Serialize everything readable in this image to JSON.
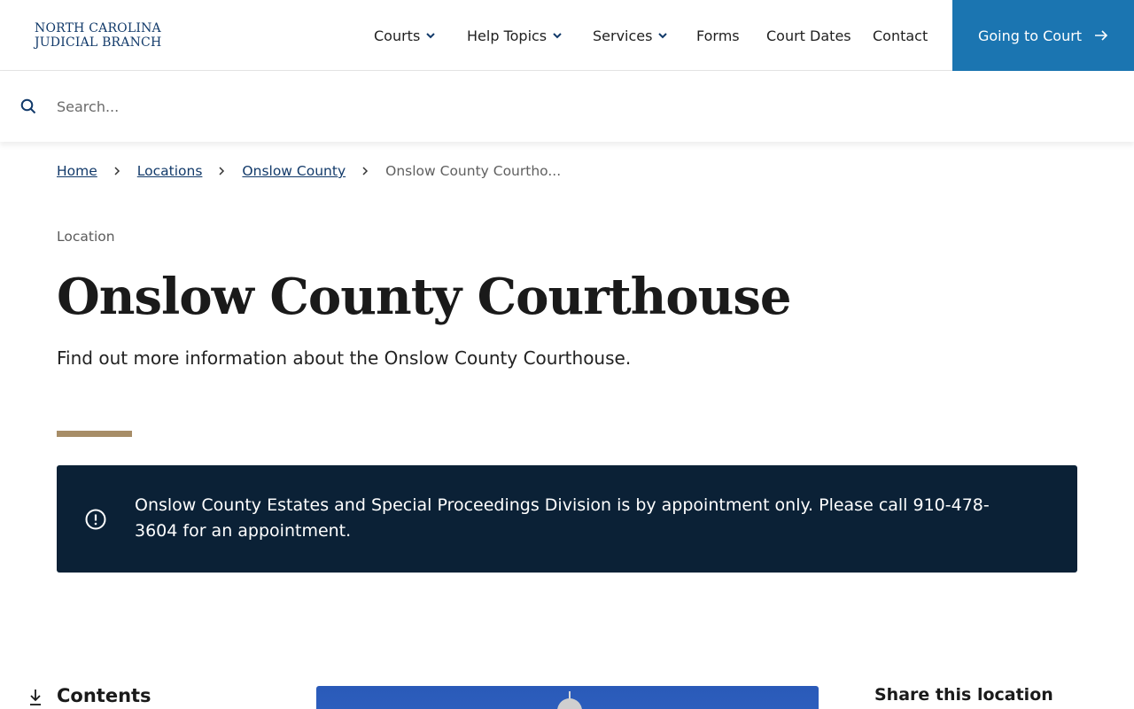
{
  "header": {
    "logo_line1": "NORTH CAROLINA",
    "logo_line2": "JUDICIAL BRANCH",
    "nav": {
      "courts": "Courts",
      "help_topics": "Help Topics",
      "services": "Services",
      "forms": "Forms",
      "court_dates": "Court Dates",
      "contact": "Contact"
    },
    "cta_label": "Going to Court",
    "brand_color": "#1b75b1"
  },
  "search": {
    "placeholder": "Search...",
    "value": ""
  },
  "breadcrumb": {
    "home": "Home",
    "locations": "Locations",
    "county": "Onslow County",
    "current": "Onslow County Courtho..."
  },
  "page": {
    "eyebrow": "Location",
    "title": "Onslow County Courthouse",
    "subtitle": "Find out more information about the Onslow County Courthouse.",
    "accent_color": "#a78d67"
  },
  "alert": {
    "text": "Onslow County Estates and Special Proceedings Division is by appointment only. Please call 910-478-3604 for an appointment.",
    "background": "#0b2136",
    "icon": "alert-circle-icon"
  },
  "sidebar": {
    "contents_label": "Contents",
    "contents_icon": "arrow-down-to-line-icon"
  },
  "share": {
    "label": "Share this location"
  }
}
